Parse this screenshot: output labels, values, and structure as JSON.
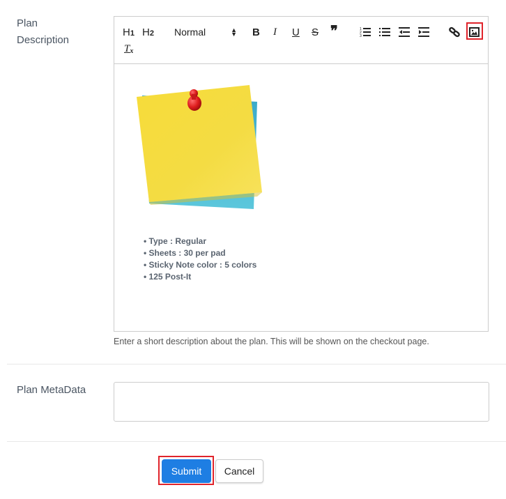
{
  "form": {
    "description_label_line1": "Plan",
    "description_label_line2": "Description",
    "metadata_label": "Plan MetaData",
    "description_help": "Enter a short description about the plan. This will be shown on the checkout page.",
    "metadata_value": ""
  },
  "toolbar": {
    "h1": "H1",
    "h2": "H2",
    "format_select": "Normal",
    "bold": "B",
    "italic": "I",
    "underline": "U",
    "strike": "S",
    "quote": "❞",
    "clear": "Tx"
  },
  "content": {
    "image": "sticky-note-image",
    "bullets": [
      "Type : Regular",
      "Sheets : 30 per pad",
      "Sticky Note color : 5 colors",
      "125 Post-It"
    ]
  },
  "actions": {
    "submit": "Submit",
    "cancel": "Cancel"
  },
  "colors": {
    "primary": "#1e7ee3",
    "highlight": "#e0242b"
  }
}
